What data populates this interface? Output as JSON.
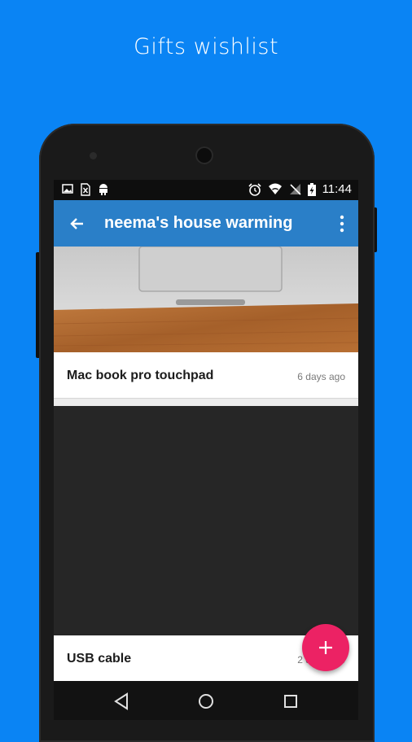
{
  "promo": {
    "headline": "Gifts wishlist"
  },
  "statusbar": {
    "left_icons": [
      "image-icon",
      "sim-error-icon",
      "android-icon"
    ],
    "right_icons": [
      "alarm-icon",
      "wifi-icon",
      "no-signal-icon",
      "battery-charging-icon"
    ],
    "time": "11:44"
  },
  "appbar": {
    "title": "neema's house warming",
    "back_icon": "arrow-back-icon",
    "menu_icon": "more-vert-icon",
    "color": "#2a7fc8"
  },
  "items": [
    {
      "name": "Mac book pro touchpad",
      "time": "6 days ago",
      "image": "macbook-touchpad-photo"
    },
    {
      "name": "USB cable",
      "time": "2 days ago",
      "image": "dark-photo"
    }
  ],
  "fab": {
    "icon": "add-icon",
    "color": "#ec2264"
  },
  "navbar": {
    "buttons": [
      "back-nav-icon",
      "home-nav-icon",
      "recents-nav-icon"
    ]
  },
  "colors": {
    "background": "#0a84f4",
    "accent": "#ec2264"
  }
}
